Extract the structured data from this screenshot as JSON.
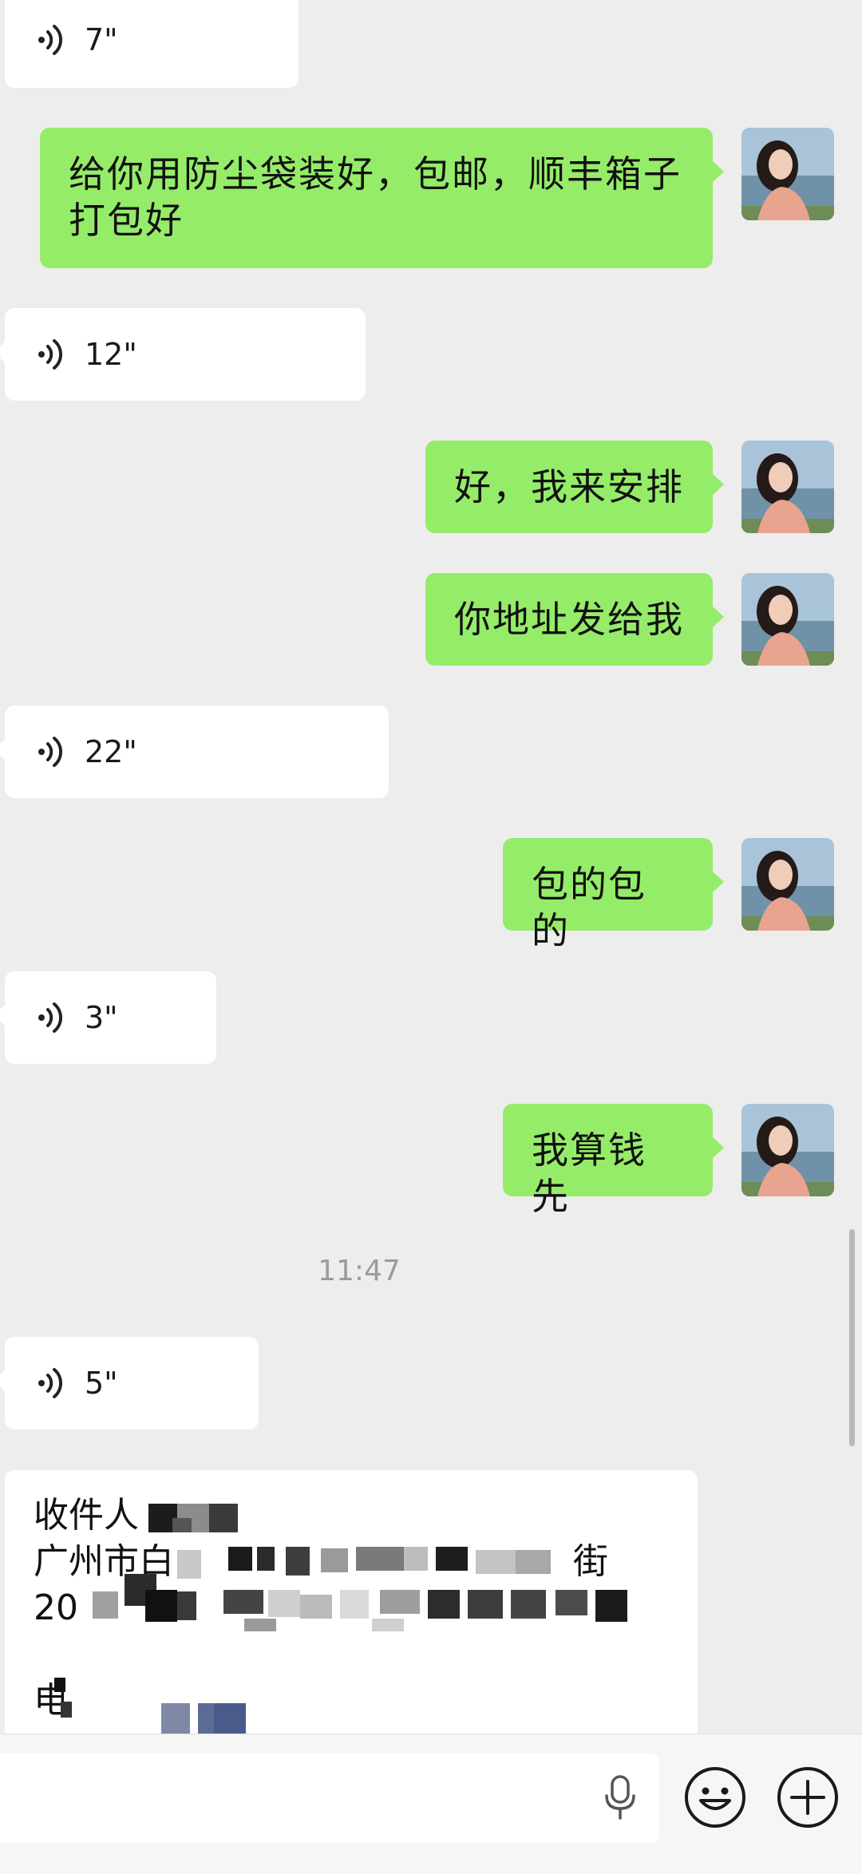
{
  "messages": [
    {
      "kind": "voice",
      "side": "in",
      "duration": "7\""
    },
    {
      "kind": "text",
      "side": "out",
      "text_line1": "给你用防尘袋装好，包邮，顺丰箱子",
      "text_line2": "打包好"
    },
    {
      "kind": "voice",
      "side": "in",
      "duration": "12\""
    },
    {
      "kind": "text",
      "side": "out",
      "text": "好，我来安排"
    },
    {
      "kind": "text",
      "side": "out",
      "text": "你地址发给我"
    },
    {
      "kind": "voice",
      "side": "in",
      "duration": "22\""
    },
    {
      "kind": "text",
      "side": "out",
      "text": "包的包的"
    },
    {
      "kind": "voice",
      "side": "in",
      "duration": "3\""
    },
    {
      "kind": "text",
      "side": "out",
      "text": "我算钱先"
    },
    {
      "kind": "timestamp",
      "text": "11:47"
    },
    {
      "kind": "voice",
      "side": "in",
      "duration": "5\""
    }
  ],
  "address_card": {
    "line1": "收件人 ",
    "line2": "广州市白",
    "line2_tail": "街",
    "line3": "20",
    "line4": "电"
  },
  "input_bar": {
    "placeholder": "",
    "mic_icon": "microphone-icon",
    "emoji_icon": "smiley-icon",
    "add_icon": "plus-circle-icon"
  },
  "colors": {
    "background": "#ededed",
    "bubble_in": "#ffffff",
    "bubble_out": "#95ec69"
  }
}
